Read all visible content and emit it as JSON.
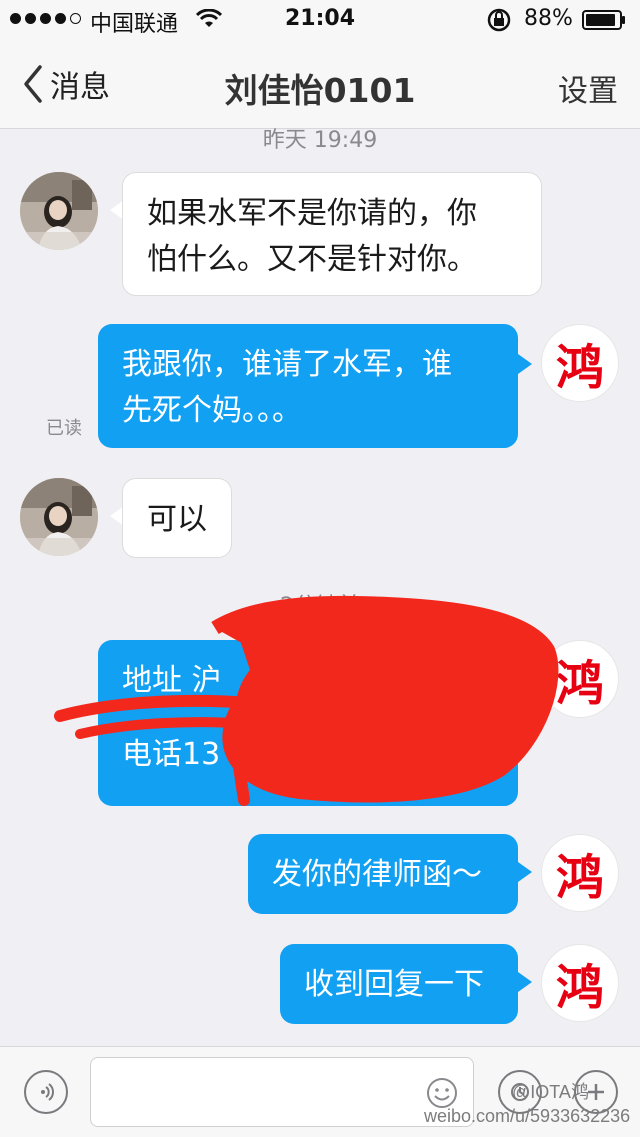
{
  "status": {
    "carrier": "中国联通",
    "time": "21:04",
    "battery": "88%"
  },
  "nav": {
    "back_label": "消息",
    "title": "刘佳怡0101",
    "settings_label": "设置"
  },
  "chat": {
    "timestamp_1": "昨天 19:49",
    "timestamp_2": "2分钟前",
    "read_label": "已读",
    "my_avatar_char": "鸿",
    "messages": [
      {
        "side": "in",
        "lines": [
          "如果水军不是你请的，你",
          "怕什么。又不是针对你。"
        ]
      },
      {
        "side": "out",
        "lines": [
          "我跟你，谁请了水军，谁",
          "先死个妈。。。"
        ]
      },
      {
        "side": "in",
        "lines": [
          "可以"
        ]
      },
      {
        "side": "out",
        "lines": [
          "地址 沪",
          "",
          "电话13"
        ]
      },
      {
        "side": "out",
        "lines": [
          "发你的律师函～"
        ]
      },
      {
        "side": "out",
        "lines": [
          "收到回复一下"
        ]
      }
    ]
  },
  "watermark": {
    "handle": "@IOTA鸿",
    "url": "weibo.com/u/5933632236"
  },
  "colors": {
    "outgoing_bubble": "#12a0f3",
    "redaction": "#f2281c",
    "avatar_glyph": "#e60012"
  }
}
